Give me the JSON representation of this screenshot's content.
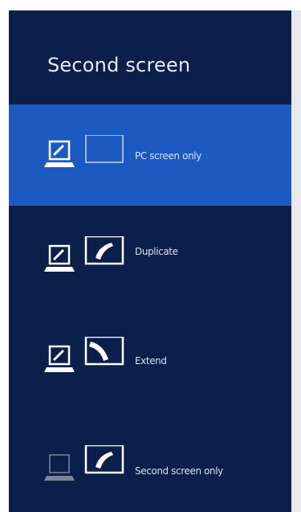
{
  "title": "Second screen",
  "options": [
    {
      "label": "PC screen only",
      "icon": "pc-screen-only-icon",
      "selected": true
    },
    {
      "label": "Duplicate",
      "icon": "duplicate-icon",
      "selected": false
    },
    {
      "label": "Extend",
      "icon": "extend-icon",
      "selected": false
    },
    {
      "label": "Second screen only",
      "icon": "second-screen-only-icon",
      "selected": false
    }
  ],
  "colors": {
    "panel_bg": "#0c1f4a",
    "selected_bg": "#1c5ac1",
    "text": "#d6e0f0"
  }
}
